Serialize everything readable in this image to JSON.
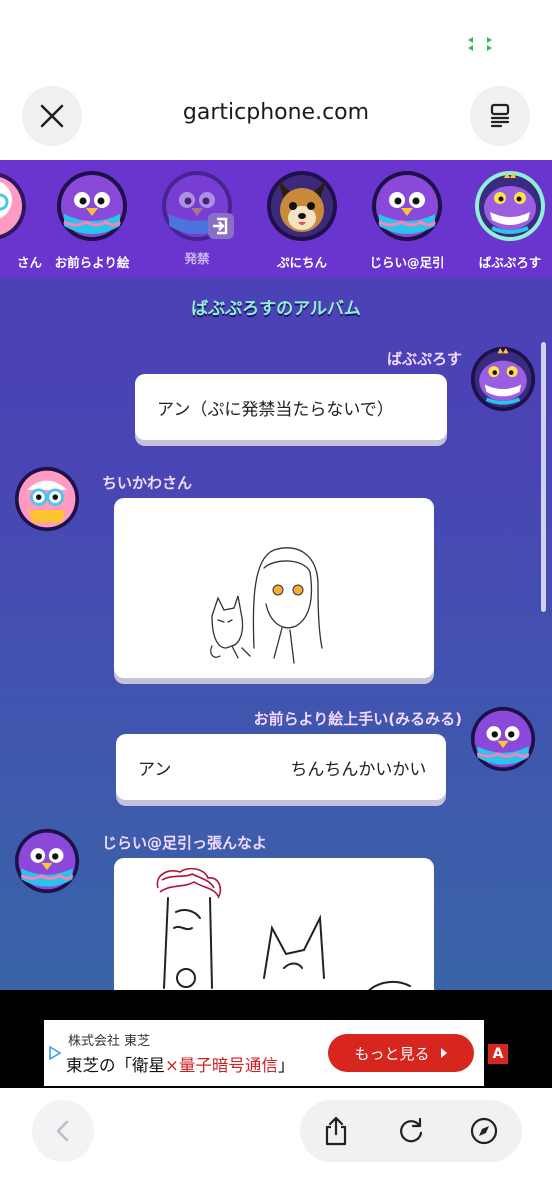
{
  "browser": {
    "url": "garticphone.com"
  },
  "game": {
    "players": [
      {
        "name": "さん",
        "avatar": "pink-cupcake-avatar",
        "banned": false
      },
      {
        "name": "お前らより絵",
        "avatar": "purple-bird-avatar",
        "banned": false
      },
      {
        "name": "発禁",
        "avatar": "purple-bird-avatar",
        "banned": true
      },
      {
        "name": "ぷにちん",
        "avatar": "dog-avatar",
        "banned": false
      },
      {
        "name": "じらい@足引",
        "avatar": "purple-bird-avatar",
        "banned": false
      },
      {
        "name": "ばぶぷろす",
        "avatar": "purple-dino-avatar",
        "banned": false
      }
    ],
    "album_title": "ばぶぷろすのアルバム",
    "messages": [
      {
        "author": "ばぶぷろす",
        "type": "text",
        "text": "アン（ぷに発禁当たらないで）"
      },
      {
        "author": "ちいかわさん",
        "type": "drawing",
        "drawing": "girl-and-cat-doodle"
      },
      {
        "author": "お前らより絵上手い(みるみる)",
        "type": "text",
        "text": "アン　　　　　　　ちんちんかいかい"
      },
      {
        "author": "じらい@足引っ張んなよ",
        "type": "drawing",
        "drawing": "red-hair-figure-and-cat-doodle"
      }
    ]
  },
  "ad": {
    "company": "株式会社 東芝",
    "headline_prefix": "東芝の「衛星",
    "headline_times": "×",
    "headline_highlight": "量子暗号通信",
    "headline_suffix": "」",
    "cta_label": "もっと見る",
    "badge": "A"
  },
  "colors": {
    "accent_purple": "#6a35cf",
    "title_mint": "#8ff0d6",
    "ad_red": "#d7261e"
  }
}
